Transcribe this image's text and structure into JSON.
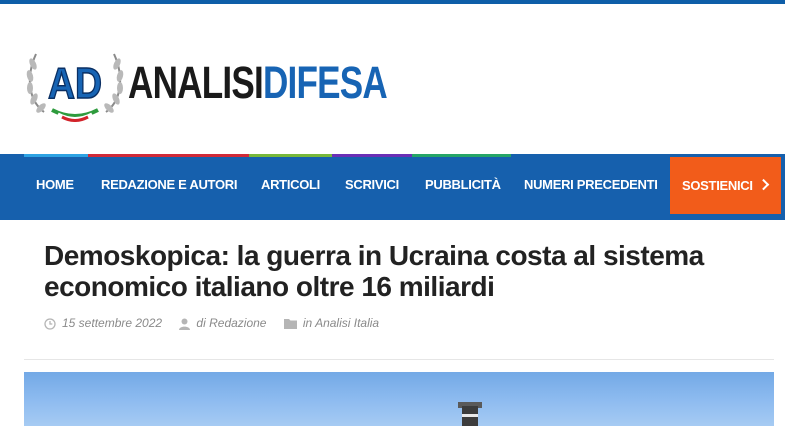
{
  "logo": {
    "emblem_text": "AD",
    "wordmark_part1": "ANALISI",
    "wordmark_part2": "DIFESA"
  },
  "colors": {
    "top_bar": "#0e5ea8",
    "nav_background": "#1660ad",
    "nav_active": "#f25c1a",
    "stripe_home": "#2ea3e3",
    "stripe_redazione": "#d02a38",
    "stripe_articoli": "#77b83a",
    "stripe_scrivici": "#6a2fb5",
    "stripe_pubblicita": "#25a567"
  },
  "nav": {
    "items": [
      {
        "label": "HOME"
      },
      {
        "label": "REDAZIONE E AUTORI"
      },
      {
        "label": "ARTICOLI"
      },
      {
        "label": "SCRIVICI"
      },
      {
        "label": "PUBBLICITÀ"
      },
      {
        "label": "NUMERI PRECEDENTI"
      },
      {
        "label": "SOSTIENICI",
        "active": true,
        "icon": "chevron-down-icon"
      }
    ]
  },
  "article": {
    "title": "Demoskopica: la guerra in Ucraina costa al sistema economico italiano oltre 16 miliardi",
    "date": "15 settembre 2022",
    "author_prefix": "di",
    "author": "Redazione",
    "category_prefix": "in",
    "category": "Analisi Italia",
    "icons": [
      "clock-icon",
      "user-icon",
      "folder-icon"
    ]
  }
}
